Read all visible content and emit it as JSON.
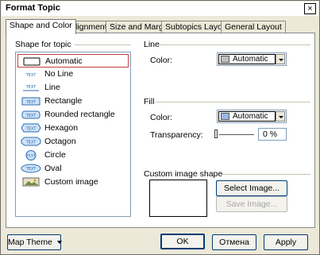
{
  "window": {
    "title": "Format Topic",
    "close_label": "×"
  },
  "tabs": [
    {
      "label": "Shape and Color",
      "active": true
    },
    {
      "label": "Alignment"
    },
    {
      "label": "Size and Margins"
    },
    {
      "label": "Subtopics Layout"
    },
    {
      "label": "General Layout"
    }
  ],
  "shape_group": {
    "label": "Shape for topic",
    "items": [
      {
        "label": "Automatic",
        "selected": true
      },
      {
        "label": "No Line",
        "icon_text": "TEXT"
      },
      {
        "label": "Line",
        "icon_text": "TEXT"
      },
      {
        "label": "Rectangle",
        "icon_text": "TEXT"
      },
      {
        "label": "Rounded rectangle",
        "icon_text": "TEXT"
      },
      {
        "label": "Hexagon",
        "icon_text": "TEXT"
      },
      {
        "label": "Octagon",
        "icon_text": "TEXT"
      },
      {
        "label": "Circle",
        "icon_text": "TEXT"
      },
      {
        "label": "Oval",
        "icon_text": "TEXT"
      },
      {
        "label": "Custom image"
      }
    ]
  },
  "line_group": {
    "label": "Line",
    "color_label": "Color:",
    "color_value": "Automatic",
    "swatch_color": "#c0c0c0"
  },
  "fill_group": {
    "label": "Fill",
    "color_label": "Color:",
    "color_value": "Automatic",
    "swatch_color": "#9ab8e6",
    "transparency_label": "Transparency:",
    "transparency_value": "0 %",
    "transparency_level": 0
  },
  "custom_image_group": {
    "label": "Custom image shape",
    "select_button": "Select Image...",
    "save_button": "Save Image..."
  },
  "footer": {
    "map_theme_button": "Map Theme",
    "ok_button": "OK",
    "cancel_button": "Отмена",
    "apply_button": "Apply"
  },
  "colors": {
    "icon_fill": "#cfe3f7",
    "icon_stroke": "#2b6cb0",
    "selection_border": "#c04040"
  }
}
